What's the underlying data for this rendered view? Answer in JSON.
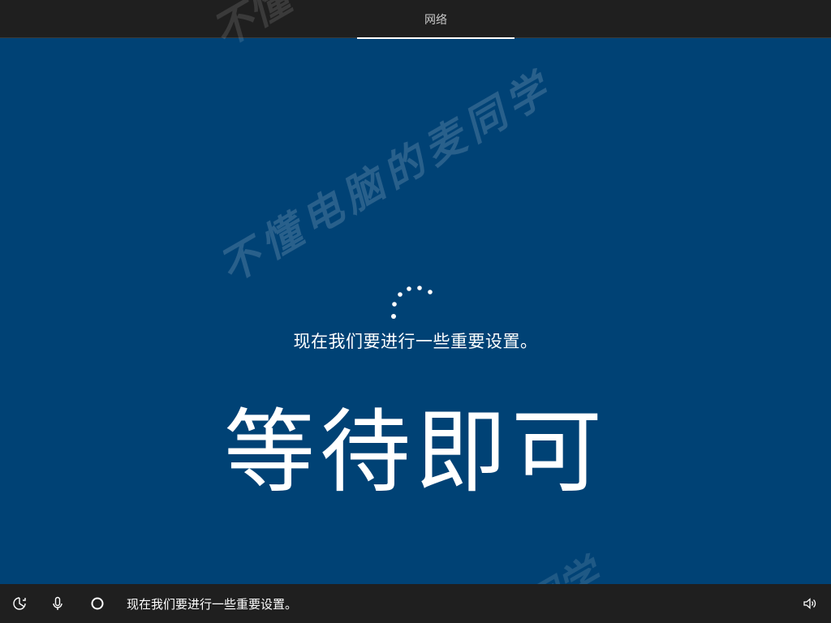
{
  "topbar": {
    "tabs": [
      {
        "label": "网络"
      }
    ]
  },
  "main": {
    "status_text": "现在我们要进行一些重要设置。",
    "caption": "等待即可",
    "watermark": "不懂电脑的麦同学"
  },
  "taskbar": {
    "icons": [
      "ease-of-access-icon",
      "microphone-icon",
      "cortana-circle-icon",
      "volume-icon"
    ],
    "narration_text": "现在我们要进行一些重要设置。"
  },
  "colors": {
    "background": "#004275",
    "bar": "#1f1f1f",
    "text": "#ffffff"
  }
}
